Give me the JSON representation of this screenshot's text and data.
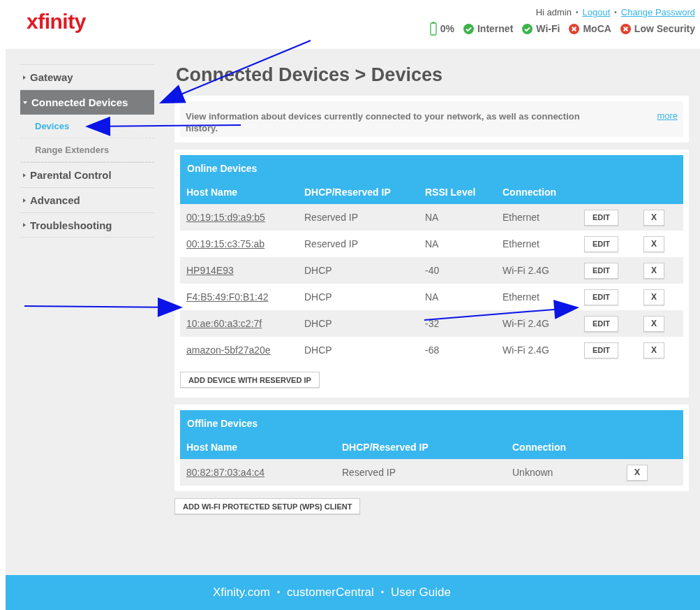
{
  "logo": "xfinity",
  "user_links": [
    {
      "kind": "text",
      "label": "Hi admin"
    },
    {
      "kind": "sep",
      "label": "•"
    },
    {
      "kind": "link",
      "label": "Logout"
    },
    {
      "kind": "sep",
      "label": "•"
    },
    {
      "kind": "link",
      "label": "Change Password"
    }
  ],
  "status": [
    {
      "kind": "battery",
      "label": "0%"
    },
    {
      "kind": "ok",
      "label": "Internet"
    },
    {
      "kind": "ok",
      "label": "Wi-Fi"
    },
    {
      "kind": "error",
      "label": "MoCA"
    },
    {
      "kind": "error",
      "label": "Low Security"
    }
  ],
  "sidebar": {
    "items": [
      {
        "label": "Gateway",
        "expanded": false,
        "selected": false
      },
      {
        "label": "Connected Devices",
        "expanded": true,
        "selected": true,
        "children": [
          {
            "label": "Devices",
            "selected": true
          },
          {
            "label": "Range Extenders",
            "selected": false
          }
        ]
      },
      {
        "label": "Parental Control",
        "expanded": false,
        "selected": false
      },
      {
        "label": "Advanced",
        "expanded": false,
        "selected": false
      },
      {
        "label": "Troubleshooting",
        "expanded": false,
        "selected": false
      }
    ]
  },
  "page_title": "Connected Devices > Devices",
  "info": {
    "text": "View information about devices currently connected to your network, as well as connection history.",
    "more": "more"
  },
  "online": {
    "title": "Online Devices",
    "columns": [
      "Host Name",
      "DHCP/Reserved IP",
      "RSSI Level",
      "Connection"
    ],
    "rows": [
      {
        "host": "00:19:15:d9:a9:b5",
        "ip": "Reserved IP",
        "rssi": "NA",
        "connection": "Ethernet",
        "edit": "EDIT",
        "remove": "X"
      },
      {
        "host": "00:19:15:c3:75:ab",
        "ip": "Reserved IP",
        "rssi": "NA",
        "connection": "Ethernet",
        "edit": "EDIT",
        "remove": "X"
      },
      {
        "host": "HP914E93",
        "ip": "DHCP",
        "rssi": "-40",
        "connection": "Wi-Fi 2.4G",
        "edit": "EDIT",
        "remove": "X"
      },
      {
        "host": "F4:B5:49:F0:B1:42",
        "ip": "DHCP",
        "rssi": "NA",
        "connection": "Ethernet",
        "edit": "EDIT",
        "remove": "X"
      },
      {
        "host": "10:ae:60:a3:c2:7f",
        "ip": "DHCP",
        "rssi": "-32",
        "connection": "Wi-Fi 2.4G",
        "edit": "EDIT",
        "remove": "X"
      },
      {
        "host": "amazon-5bf27a20e",
        "ip": "DHCP",
        "rssi": "-68",
        "connection": "Wi-Fi 2.4G",
        "edit": "EDIT",
        "remove": "X"
      }
    ],
    "add_button": "ADD DEVICE WITH RESERVED IP"
  },
  "offline": {
    "title": "Offline Devices",
    "columns": [
      "Host Name",
      "DHCP/Reserved IP",
      "Connection"
    ],
    "rows": [
      {
        "host": "80:82:87:03:a4:c4",
        "ip": "Reserved IP",
        "connection": "Unknown",
        "remove": "X"
      }
    ]
  },
  "wps_button": "ADD WI-FI PROTECTED SETUP (WPS) CLIENT",
  "footer_links": [
    {
      "kind": "link",
      "label": "Xfinity.com"
    },
    {
      "kind": "sep",
      "label": "•"
    },
    {
      "kind": "link",
      "label": "customerCentral"
    },
    {
      "kind": "sep",
      "label": "•"
    },
    {
      "kind": "link",
      "label": "User Guide"
    }
  ]
}
